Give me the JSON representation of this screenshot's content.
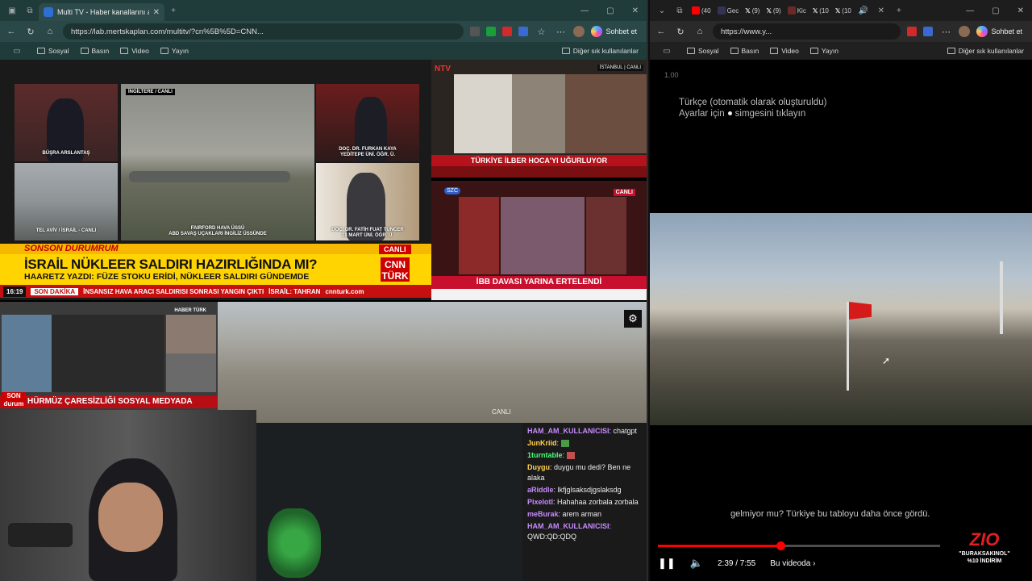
{
  "left_window": {
    "tab": {
      "title": "Multi TV - Haber kanallarını aynı a"
    },
    "url": "https://lab.mertskaplan.com/multitv/?cn%5B%5D=CNN...",
    "chat_button": "Sohbet et",
    "bookmarks": [
      "Sosyal",
      "Basın",
      "Video",
      "Yayın"
    ],
    "bookmarks_right": "Diğer sık kullanılanlar"
  },
  "right_window": {
    "tabs": [
      "(40",
      "Gec",
      "(9)",
      "(9)",
      "Kic",
      "(10",
      "(10"
    ],
    "url": "https://www.y...",
    "chat_button": "Sohbet et",
    "bookmarks": [
      "Sosyal",
      "Basın",
      "Video",
      "Yayın"
    ],
    "bookmarks_right": "Diğer sık kullanılanlar"
  },
  "cnn": {
    "tag": "İNGİLTERE / CANLI",
    "name1": "BÜŞRA ARSLANTAŞ",
    "name2": "DOÇ. DR. FURKAN KAYA",
    "name2b": "YEDİTEPE ÜNİ. ÖĞR. Ü.",
    "loc1": "TEL AVİV / İSRAİL - CANLI",
    "loc2": "FAIRFORD HAVA ÜSSÜ",
    "loc2b": "ABD SAVAŞ UÇAKLARI İNGİLİZ ÜSSÜNDE",
    "name3": "DOÇ. DR. FATİH FUAT TUNCER",
    "name3b": "18 MART ÜNİ. ÖĞR. Ü.",
    "sonson": "SONSON DURUMRUM",
    "canli": "CANLI",
    "headline": "İSRAİL NÜKLEER SALDIRI HAZIRLIĞINDA MI?",
    "subhead": "HAARETZ YAZDI: FÜZE STOKU ERİDİ, NÜKLEER SALDIRI GÜNDEMDE",
    "logo": "CNN TÜRK",
    "time": "16:19",
    "sondakika": "SON DAKİKA",
    "ticker": "İNSANSIZ HAVA ARACI SALDIRISI SONRASI YANGIN ÇIKTI",
    "ticker2": "İSRAİL: TAHRAN",
    "site": "cnnturk.com"
  },
  "ntv": {
    "logo": "NTV",
    "badge": "İSTANBUL | CANLI",
    "headline": "TÜRKİYE İLBER HOCA'YI UĞURLUYOR"
  },
  "szc": {
    "logo": "SZC",
    "canli": "CANLI",
    "headline": "İBB DAVASI YARINA ERTELENDİ"
  },
  "haberturk": {
    "logo": "HABER TÜRK",
    "son": "SON durum",
    "headline": "HÜRMÜZ ÇARESİZLİĞİ SOSYAL MEDYADA"
  },
  "city": {
    "canli": "CANLI"
  },
  "chat": [
    {
      "user": "HAM_AM_KULLANICISI",
      "msg": "chatgpt",
      "color": "#c78aff"
    },
    {
      "user": "JunKriid",
      "msg": "",
      "color": "#ffd44d"
    },
    {
      "user": "1turntable",
      "msg": "",
      "color": "#4dff7a"
    },
    {
      "user": "Duygu",
      "msg": "duygu mu dedi? Ben ne alaka",
      "color": "#ffd44d"
    },
    {
      "user": "aRiddle",
      "msg": "lkfjglsaksdjgslaksdg",
      "color": "#c78aff"
    },
    {
      "user": "Pixelotl",
      "msg": "Hahahaa zorbala zorbala",
      "color": "#c78aff"
    },
    {
      "user": "meBurak",
      "msg": "arem arman",
      "color": "#c78aff"
    },
    {
      "user": "HAM_AM_KULLANICISI",
      "msg": "QWD:QD:QDQ",
      "color": "#c78aff"
    }
  ],
  "video": {
    "speed": "1.00",
    "caption_line1": "Türkçe (otomatik olarak oluşturuldu)",
    "caption_line2a": "Ayarlar için",
    "caption_line2b": "simgesini tıklayın",
    "subtitle": "gelmiyor mu? Türkiye bu tabloyu daha önce gördü.",
    "time": "2:39 / 7:55",
    "progress": 0.335,
    "chapter": "Bu videoda",
    "logo_z": "ZIO",
    "logo_text1": "\"BURAKSAKINOL\"",
    "logo_text2": "%10 İNDİRİM"
  }
}
